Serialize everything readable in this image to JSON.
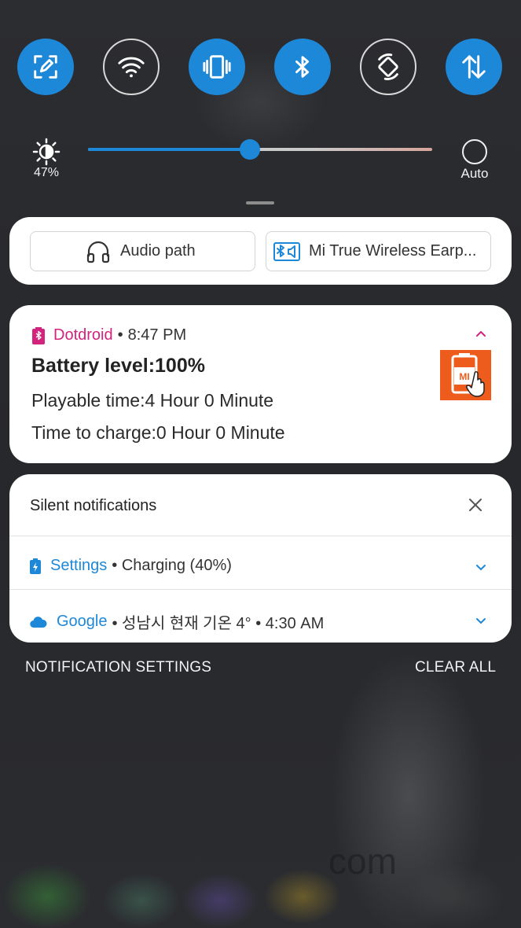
{
  "quick_toggles": [
    {
      "name": "screenshot",
      "icon": "screen-capture-icon",
      "state": "on"
    },
    {
      "name": "wifi",
      "icon": "wifi-icon",
      "state": "off"
    },
    {
      "name": "vibrate",
      "icon": "vibrate-icon",
      "state": "on"
    },
    {
      "name": "bluetooth",
      "icon": "bluetooth-icon",
      "state": "on"
    },
    {
      "name": "auto-rotate",
      "icon": "rotate-icon",
      "state": "off"
    },
    {
      "name": "mobile-data",
      "icon": "data-arrows-icon",
      "state": "on"
    }
  ],
  "brightness": {
    "percent_label": "47%",
    "level": 0.47,
    "auto_label": "Auto"
  },
  "media_output": {
    "audio_path_label": "Audio path",
    "device_label": "Mi True Wireless Earp..."
  },
  "dotdroid": {
    "app": "Dotdroid",
    "separator": "•",
    "time": "8:47 PM",
    "title": "Battery level:100%",
    "line1": "Playable time:4 Hour 0 Minute",
    "line2": "Time to charge:0 Hour 0 Minute",
    "thumb_text": "MI"
  },
  "silent": {
    "title": "Silent notifications",
    "rows": [
      {
        "app": "Settings",
        "text": "• Charging (40%)",
        "icon": "battery-charging-icon"
      },
      {
        "app": "Google",
        "text": "• 성남시 현재 기온 4° • 4:30 AM",
        "icon": "cloud-icon"
      }
    ]
  },
  "footer": {
    "settings_label": "NOTIFICATION SETTINGS",
    "clear_label": "CLEAR ALL"
  },
  "watermark": "com",
  "colors": {
    "accent": "#1e88d8",
    "dotdroid": "#d2237d",
    "thumb": "#ee5c1d"
  }
}
